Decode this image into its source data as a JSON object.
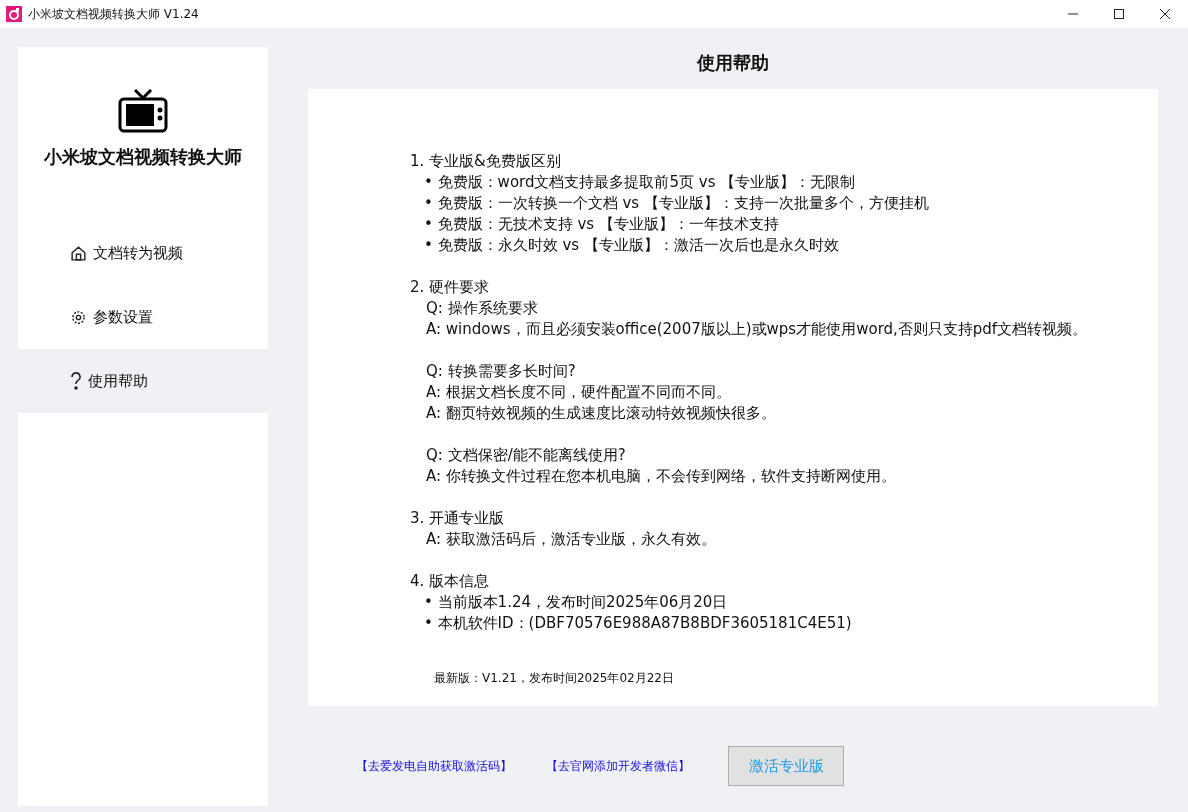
{
  "window": {
    "title": "小米坡文档视频转换大师 V1.24"
  },
  "sidebar": {
    "app_name": "小米坡文档视频转换大师",
    "items": [
      {
        "label": "文档转为视频",
        "selected": false
      },
      {
        "label": "参数设置",
        "selected": false
      },
      {
        "label": "使用帮助",
        "selected": true
      }
    ]
  },
  "page_title": "使用帮助",
  "help": {
    "sections": [
      {
        "heading": "1. 专业版&免费版区别",
        "blocks": [
          [
            {
              "kind": "bullet",
              "text": "• 免费版：word文档支持最多提取前5页 vs 【专业版】：无限制"
            },
            {
              "kind": "bullet",
              "text": "• 免费版：一次转换一个文档 vs 【专业版】：支持一次批量多个，方便挂机"
            },
            {
              "kind": "bullet",
              "text": "• 免费版：无技术支持 vs 【专业版】：一年技术支持"
            },
            {
              "kind": "bullet",
              "text": "• 免费版：永久时效 vs 【专业版】：激活一次后也是永久时效"
            }
          ]
        ]
      },
      {
        "heading": "2. 硬件要求",
        "blocks": [
          [
            {
              "kind": "plain",
              "text": "Q: 操作系统要求"
            },
            {
              "kind": "plain",
              "text": "A: windows，而且必须安装office(2007版以上)或wps才能使用word,否则只支持pdf文档转视频。"
            }
          ],
          [
            {
              "kind": "plain",
              "text": "Q: 转换需要多长时间?"
            },
            {
              "kind": "plain",
              "text": "A: 根据文档长度不同，硬件配置不同而不同。"
            },
            {
              "kind": "plain",
              "text": "A: 翻页特效视频的生成速度比滚动特效视频快很多。"
            }
          ],
          [
            {
              "kind": "plain",
              "text": "Q: 文档保密/能不能离线使用?"
            },
            {
              "kind": "plain",
              "text": "A: 你转换文件过程在您本机电脑，不会传到网络，软件支持断网使用。"
            }
          ]
        ]
      },
      {
        "heading": "3. 开通专业版",
        "blocks": [
          [
            {
              "kind": "plain",
              "text": "A: 获取激活码后，激活专业版，永久有效。"
            }
          ]
        ]
      },
      {
        "heading": "4. 版本信息",
        "blocks": [
          [
            {
              "kind": "bullet",
              "text": "• 当前版本1.24，发布时间2025年06月20日"
            },
            {
              "kind": "bullet",
              "text": "• 本机软件ID：(DBF70576E988A87B8BDF3605181C4E51)"
            }
          ]
        ]
      }
    ],
    "latest_version": "最新版：V1.21，发布时间2025年02月22日"
  },
  "footer": {
    "links": [
      "【去爱发电自助获取激活码】",
      "【去官网添加开发者微信】"
    ],
    "button": "激活专业版"
  }
}
